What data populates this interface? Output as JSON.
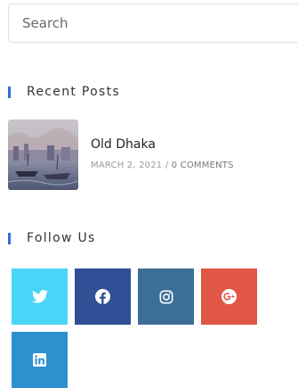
{
  "search": {
    "placeholder": "Search"
  },
  "recent_posts": {
    "title": "Recent Posts",
    "posts": [
      {
        "title": "Old Dhaka",
        "date": "MARCH 2, 2021",
        "separator": "/",
        "comments": "0 COMMENTS"
      }
    ]
  },
  "follow": {
    "title": "Follow Us",
    "buttons": [
      {
        "name": "twitter",
        "icon": "twitter-icon",
        "color": "#49d5f7"
      },
      {
        "name": "facebook",
        "icon": "facebook-icon",
        "color": "#304f96"
      },
      {
        "name": "instagram",
        "icon": "instagram-icon",
        "color": "#3c6e98"
      },
      {
        "name": "google-plus",
        "icon": "google-plus-icon",
        "color": "#e05745"
      },
      {
        "name": "linkedin",
        "icon": "linkedin-icon",
        "color": "#2d91cf"
      }
    ]
  },
  "colors": {
    "accent_bar": "#2f6ee0"
  }
}
